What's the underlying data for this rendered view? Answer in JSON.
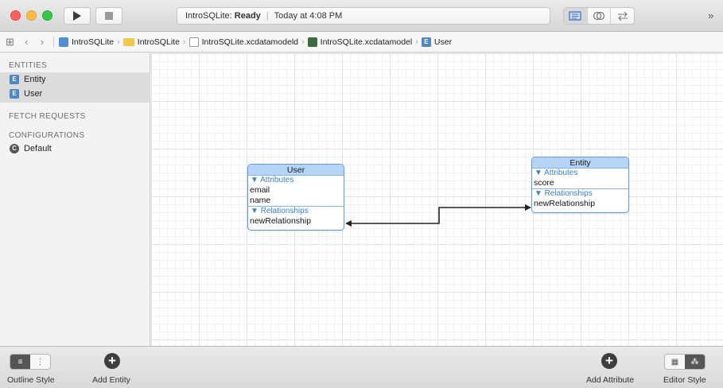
{
  "toolbar": {
    "activity_project": "IntroSQLite:",
    "activity_status": "Ready",
    "activity_time": "Today at 4:08 PM",
    "more_glyph": "»"
  },
  "jumpbar": {
    "crumbs": [
      "IntroSQLite",
      "IntroSQLite",
      "IntroSQLite.xcdatamodeld",
      "IntroSQLite.xcdatamodel",
      "User"
    ]
  },
  "sidebar": {
    "entities_title": "ENTITIES",
    "entities": [
      {
        "badge": "E",
        "label": "Entity"
      },
      {
        "badge": "E",
        "label": "User"
      }
    ],
    "fetch_title": "FETCH REQUESTS",
    "configurations_title": "CONFIGURATIONS",
    "configurations": [
      {
        "badge": "C",
        "label": "Default"
      }
    ]
  },
  "graph": {
    "user": {
      "title": "User",
      "attributes_label": "▼ Attributes",
      "attributes": [
        "email",
        "name"
      ],
      "relationships_label": "▼ Relationships",
      "relationships": [
        "newRelationship"
      ]
    },
    "entity": {
      "title": "Entity",
      "attributes_label": "▼ Attributes",
      "attributes": [
        "score"
      ],
      "relationships_label": "▼ Relationships",
      "relationships": [
        "newRelationship"
      ]
    }
  },
  "bottombar": {
    "outline_style_label": "Outline Style",
    "add_entity_label": "Add Entity",
    "add_attribute_label": "Add Attribute",
    "editor_style_label": "Editor Style"
  },
  "colors": {
    "accent": "#3b7dd8",
    "entity_border": "#5d9ee6",
    "entity_header": "#b6d4f6"
  }
}
